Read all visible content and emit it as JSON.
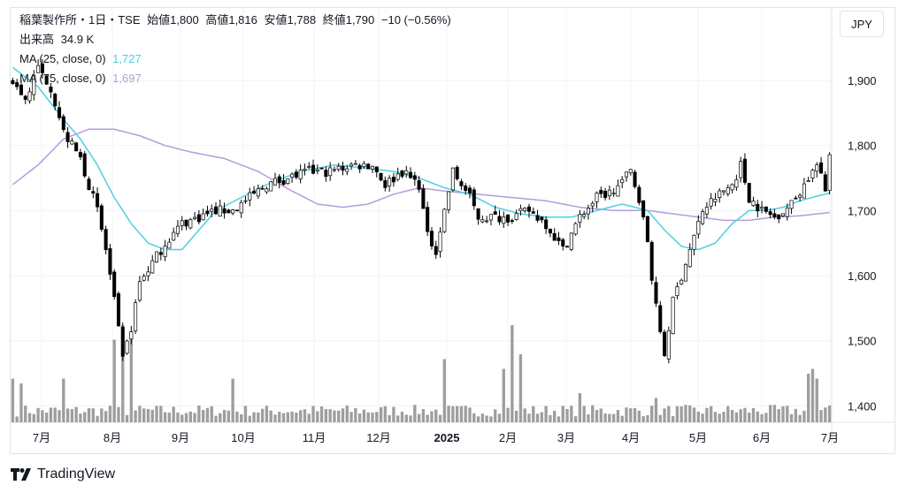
{
  "header": {
    "symbol_line": "稲葉製作所・1日・TSE",
    "open_label": "始値",
    "open": "1,800",
    "high_label": "高値",
    "high": "1,816",
    "low_label": "安値",
    "low": "1,788",
    "close_label": "終値",
    "close": "1,790",
    "change": "−10 (−0.56%)"
  },
  "volume_legend": {
    "label": "出来高",
    "value": "34.9 K"
  },
  "ma_legends": [
    {
      "label": "MA (25, close, 0)",
      "value": "1,727",
      "color": "#4dd0e1"
    },
    {
      "label": "MA (75, close, 0)",
      "value": "1,697",
      "color": "#b39ddb"
    }
  ],
  "currency": "JPY",
  "brand": "TradingView",
  "chart_data": {
    "type": "candlestick",
    "y_ticks": [
      "1,900",
      "1,800",
      "1,700",
      "1,600",
      "1,500",
      "1,400"
    ],
    "ylim": [
      1380,
      1950
    ],
    "x_ticks": [
      "7月",
      "8月",
      "9月",
      "10月",
      "11月",
      "12月",
      "2025",
      "2月",
      "3月",
      "4月",
      "5月",
      "6月",
      "7月"
    ],
    "grid": true,
    "price_path": [
      [
        0,
        1900
      ],
      [
        3,
        1870
      ],
      [
        6,
        1920
      ],
      [
        9,
        1890
      ],
      [
        12,
        1820
      ],
      [
        16,
        1780
      ],
      [
        20,
        1700
      ],
      [
        22,
        1640
      ],
      [
        24,
        1560
      ],
      [
        26,
        1470
      ],
      [
        28,
        1520
      ],
      [
        30,
        1590
      ],
      [
        33,
        1620
      ],
      [
        36,
        1650
      ],
      [
        40,
        1680
      ],
      [
        44,
        1690
      ],
      [
        48,
        1700
      ],
      [
        52,
        1700
      ],
      [
        56,
        1720
      ],
      [
        60,
        1740
      ],
      [
        65,
        1750
      ],
      [
        70,
        1760
      ],
      [
        75,
        1760
      ],
      [
        80,
        1770
      ],
      [
        85,
        1770
      ],
      [
        88,
        1740
      ],
      [
        92,
        1760
      ],
      [
        96,
        1740
      ],
      [
        98,
        1660
      ],
      [
        100,
        1640
      ],
      [
        104,
        1760
      ],
      [
        108,
        1720
      ],
      [
        110,
        1690
      ],
      [
        113,
        1690
      ],
      [
        118,
        1690
      ],
      [
        122,
        1700
      ],
      [
        126,
        1680
      ],
      [
        130,
        1640
      ],
      [
        134,
        1690
      ],
      [
        138,
        1720
      ],
      [
        142,
        1730
      ],
      [
        146,
        1760
      ],
      [
        148,
        1720
      ],
      [
        150,
        1650
      ],
      [
        152,
        1550
      ],
      [
        154,
        1480
      ],
      [
        156,
        1560
      ],
      [
        158,
        1600
      ],
      [
        160,
        1640
      ],
      [
        163,
        1700
      ],
      [
        166,
        1720
      ],
      [
        170,
        1740
      ],
      [
        172,
        1770
      ],
      [
        174,
        1720
      ],
      [
        177,
        1700
      ],
      [
        180,
        1690
      ],
      [
        184,
        1710
      ],
      [
        188,
        1750
      ],
      [
        190,
        1770
      ],
      [
        192,
        1730
      ],
      [
        193,
        1790
      ]
    ],
    "ma25_path": [
      [
        0,
        1920
      ],
      [
        6,
        1890
      ],
      [
        12,
        1840
      ],
      [
        16,
        1810
      ],
      [
        20,
        1770
      ],
      [
        24,
        1720
      ],
      [
        28,
        1680
      ],
      [
        32,
        1650
      ],
      [
        36,
        1640
      ],
      [
        40,
        1640
      ],
      [
        44,
        1670
      ],
      [
        48,
        1700
      ],
      [
        54,
        1720
      ],
      [
        60,
        1740
      ],
      [
        68,
        1760
      ],
      [
        76,
        1770
      ],
      [
        84,
        1765
      ],
      [
        90,
        1760
      ],
      [
        96,
        1750
      ],
      [
        102,
        1735
      ],
      [
        108,
        1725
      ],
      [
        114,
        1705
      ],
      [
        120,
        1695
      ],
      [
        126,
        1690
      ],
      [
        132,
        1690
      ],
      [
        138,
        1700
      ],
      [
        144,
        1710
      ],
      [
        150,
        1700
      ],
      [
        154,
        1670
      ],
      [
        158,
        1645
      ],
      [
        162,
        1640
      ],
      [
        166,
        1650
      ],
      [
        170,
        1680
      ],
      [
        174,
        1700
      ],
      [
        178,
        1700
      ],
      [
        182,
        1705
      ],
      [
        186,
        1715
      ],
      [
        190,
        1722
      ],
      [
        193,
        1727
      ]
    ],
    "ma75_path": [
      [
        0,
        1740
      ],
      [
        6,
        1770
      ],
      [
        12,
        1810
      ],
      [
        18,
        1825
      ],
      [
        24,
        1825
      ],
      [
        30,
        1815
      ],
      [
        36,
        1800
      ],
      [
        42,
        1790
      ],
      [
        50,
        1780
      ],
      [
        58,
        1760
      ],
      [
        66,
        1730
      ],
      [
        72,
        1710
      ],
      [
        78,
        1705
      ],
      [
        84,
        1710
      ],
      [
        90,
        1725
      ],
      [
        96,
        1735
      ],
      [
        102,
        1730
      ],
      [
        110,
        1725
      ],
      [
        118,
        1720
      ],
      [
        126,
        1715
      ],
      [
        134,
        1705
      ],
      [
        142,
        1700
      ],
      [
        150,
        1700
      ],
      [
        156,
        1695
      ],
      [
        162,
        1690
      ],
      [
        168,
        1685
      ],
      [
        174,
        1685
      ],
      [
        180,
        1690
      ],
      [
        186,
        1692
      ],
      [
        193,
        1697
      ]
    ],
    "volume_spikes": [
      [
        0,
        0.45
      ],
      [
        2,
        0.4
      ],
      [
        12,
        0.45
      ],
      [
        24,
        0.85
      ],
      [
        26,
        1.0
      ],
      [
        28,
        0.9
      ],
      [
        52,
        0.45
      ],
      [
        102,
        0.65
      ],
      [
        116,
        0.55
      ],
      [
        118,
        1.0
      ],
      [
        120,
        0.7
      ],
      [
        134,
        0.3
      ],
      [
        152,
        0.25
      ],
      [
        188,
        0.5
      ],
      [
        189,
        0.55
      ],
      [
        190,
        0.45
      ]
    ],
    "colors": {
      "up_body": "#ffffff",
      "down_body": "#000000",
      "wick": "#000000",
      "volume": "#9e9e9e",
      "ma25": "#4dd0e1",
      "ma75": "#b39ddb",
      "grid": "#f0f3fa"
    }
  }
}
